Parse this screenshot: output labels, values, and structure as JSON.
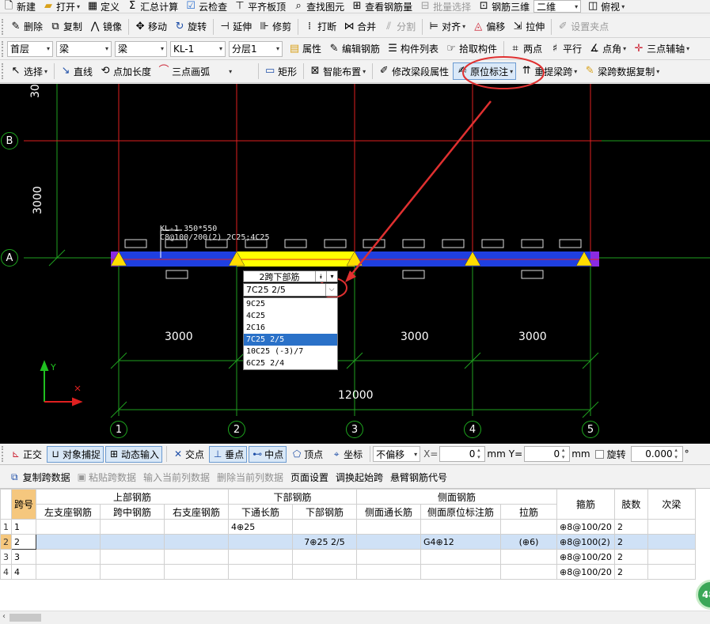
{
  "toolbar_row1": {
    "items": [
      {
        "icon": "new-icon",
        "label": "新建"
      },
      {
        "icon": "open-icon",
        "label": "打开"
      },
      {
        "icon": "define-icon",
        "label": "定义"
      },
      {
        "icon": "sum-icon",
        "label": "汇总计算"
      },
      {
        "icon": "cloud-check-icon",
        "label": "云检查"
      },
      {
        "icon": "flush-icon",
        "label": "平齐板顶"
      },
      {
        "icon": "find-icon",
        "label": "查找图元"
      },
      {
        "icon": "view-rebar-icon",
        "label": "查看钢筋量"
      },
      {
        "icon": "batch-select-icon",
        "label": "批量选择"
      },
      {
        "icon": "rebar-3d-icon",
        "label": "钢筋三维"
      }
    ],
    "view_combo": "二维",
    "view_mode": "俯视"
  },
  "toolbar_row2": {
    "items": [
      {
        "icon": "delete-icon",
        "label": "删除"
      },
      {
        "icon": "copy-icon",
        "label": "复制"
      },
      {
        "icon": "mirror-icon",
        "label": "镜像"
      },
      {
        "icon": "move-icon",
        "label": "移动"
      },
      {
        "icon": "rotate-icon",
        "label": "旋转"
      },
      {
        "icon": "extend-icon",
        "label": "延伸"
      },
      {
        "icon": "trim-icon",
        "label": "修剪"
      },
      {
        "icon": "break-icon",
        "label": "打断"
      },
      {
        "icon": "merge-icon",
        "label": "合并"
      },
      {
        "icon": "split-icon",
        "label": "分割"
      },
      {
        "icon": "align-icon",
        "label": "对齐"
      },
      {
        "icon": "offset-icon",
        "label": "偏移"
      },
      {
        "icon": "stretch-icon",
        "label": "拉伸"
      },
      {
        "icon": "grip-icon",
        "label": "设置夹点"
      }
    ]
  },
  "toolbar_row3": {
    "floor": "首层",
    "category": "梁",
    "type": "梁",
    "member": "KL-1",
    "layer": "分层1",
    "items": [
      {
        "icon": "property-icon",
        "label": "属性"
      },
      {
        "icon": "edit-rebar-icon",
        "label": "编辑钢筋"
      },
      {
        "icon": "member-list-icon",
        "label": "构件列表"
      },
      {
        "icon": "pick-member-icon",
        "label": "拾取构件"
      },
      {
        "icon": "two-point-icon",
        "label": "两点"
      },
      {
        "icon": "parallel-icon",
        "label": "平行"
      },
      {
        "icon": "point-angle-icon",
        "label": "点角"
      },
      {
        "icon": "three-point-axis-icon",
        "label": "三点辅轴"
      }
    ]
  },
  "toolbar_row4": {
    "items": [
      {
        "icon": "select-icon",
        "label": "选择"
      },
      {
        "icon": "line-icon",
        "label": "直线"
      },
      {
        "icon": "point-extend-icon",
        "label": "点加长度"
      },
      {
        "icon": "arc-icon",
        "label": "三点画弧"
      },
      {
        "icon": "rect-icon",
        "label": "矩形"
      },
      {
        "icon": "smart-layout-icon",
        "label": "智能布置"
      },
      {
        "icon": "modify-span-icon",
        "label": "修改梁段属性"
      },
      {
        "icon": "in-situ-label-icon",
        "label": "原位标注"
      },
      {
        "icon": "relift-span-icon",
        "label": "重提梁跨"
      },
      {
        "icon": "copy-span-data-icon",
        "label": "梁跨数据复制"
      }
    ]
  },
  "canvas": {
    "colors": {
      "background": "#000000",
      "grid": "#1fa01f",
      "beam": "#1f3fe0",
      "selected_span": "#ffff00",
      "axis_red": "#e02020",
      "support": "#ffdd00",
      "end_cap": "#8a2be2",
      "callout": "#e03030"
    },
    "row_axes": [
      {
        "label": "B"
      },
      {
        "label": "A"
      }
    ],
    "col_axes": [
      {
        "label": "1"
      },
      {
        "label": "2"
      },
      {
        "label": "3"
      },
      {
        "label": "4"
      },
      {
        "label": "5"
      }
    ],
    "dimensions": {
      "vertical_top": "30",
      "vertical": "3000",
      "spans": [
        "3000",
        "3000",
        "3000"
      ],
      "total": "12000"
    },
    "beam_note_line1": "KL-1 350*550",
    "beam_note_line2": "C8@100/200(2) 2C25;4C25",
    "popup": {
      "type_label": "2跨下部筋",
      "value": "7C25 2/5",
      "options": [
        "9C25",
        "4C25",
        "2C16",
        "7C25 2/5",
        "10C25 (-3)/7",
        "6C25 2/4"
      ],
      "selected_index": 3
    },
    "ucs": {
      "x": "X",
      "y": "Y"
    }
  },
  "statusbar": {
    "ortho": "正交",
    "osnap": "对象捕捉",
    "dynamic_input": "动态输入",
    "intersect": "交点",
    "perpendicular": "垂点",
    "midpoint": "中点",
    "vertex": "顶点",
    "coordinate": "坐标",
    "offset_mode": "不偏移",
    "x_label": "X=",
    "x_value": "0",
    "x_unit": "mm",
    "y_label": "Y=",
    "y_value": "0",
    "y_unit": "mm",
    "rotate_label": "旋转",
    "rotate_value": "0.000",
    "degree": "°"
  },
  "panel_toolbar": [
    {
      "label": "复制跨数据",
      "enabled": true
    },
    {
      "label": "粘贴跨数据",
      "enabled": false
    },
    {
      "label": "输入当前列数据",
      "enabled": false
    },
    {
      "label": "删除当前列数据",
      "enabled": false
    },
    {
      "label": "页面设置",
      "enabled": true
    },
    {
      "label": "调换起始跨",
      "enabled": true
    },
    {
      "label": "悬臂钢筋代号",
      "enabled": true
    }
  ],
  "table": {
    "span_header": "跨号",
    "groups": {
      "top": "上部钢筋",
      "bottom": "下部钢筋",
      "side": "侧面钢筋",
      "stirrup": "箍筋",
      "legs": "肢数",
      "secondary": "次梁"
    },
    "subheaders": [
      "左支座钢筋",
      "跨中钢筋",
      "右支座钢筋",
      "下通长筋",
      "下部钢筋",
      "侧面通长筋",
      "侧面原位标注筋",
      "拉筋"
    ],
    "rows": [
      {
        "n": "1",
        "span": "1",
        "left": "",
        "mid": "",
        "right": "",
        "bot_through": "4⊕25",
        "bot": "",
        "side_through": "",
        "side_label": "",
        "tie": "",
        "stirrup": "⊕8@100/20",
        "legs": "2"
      },
      {
        "n": "2",
        "span": "2",
        "left": "",
        "mid": "",
        "right": "",
        "bot_through": "",
        "bot": "7⊕25 2/5",
        "side_through": "",
        "side_label": "G4⊕12",
        "tie": "(⊕6)",
        "stirrup": "⊕8@100(2)",
        "legs": "2"
      },
      {
        "n": "3",
        "span": "3",
        "left": "",
        "mid": "",
        "right": "",
        "bot_through": "",
        "bot": "",
        "side_through": "",
        "side_label": "",
        "tie": "",
        "stirrup": "⊕8@100/20",
        "legs": "2"
      },
      {
        "n": "4",
        "span": "4",
        "left": "",
        "mid": "",
        "right": "",
        "bot_through": "",
        "bot": "",
        "side_through": "",
        "side_label": "",
        "tie": "",
        "stirrup": "⊕8@100/20",
        "legs": "2"
      }
    ],
    "selected_row": 1
  },
  "badge": "48"
}
